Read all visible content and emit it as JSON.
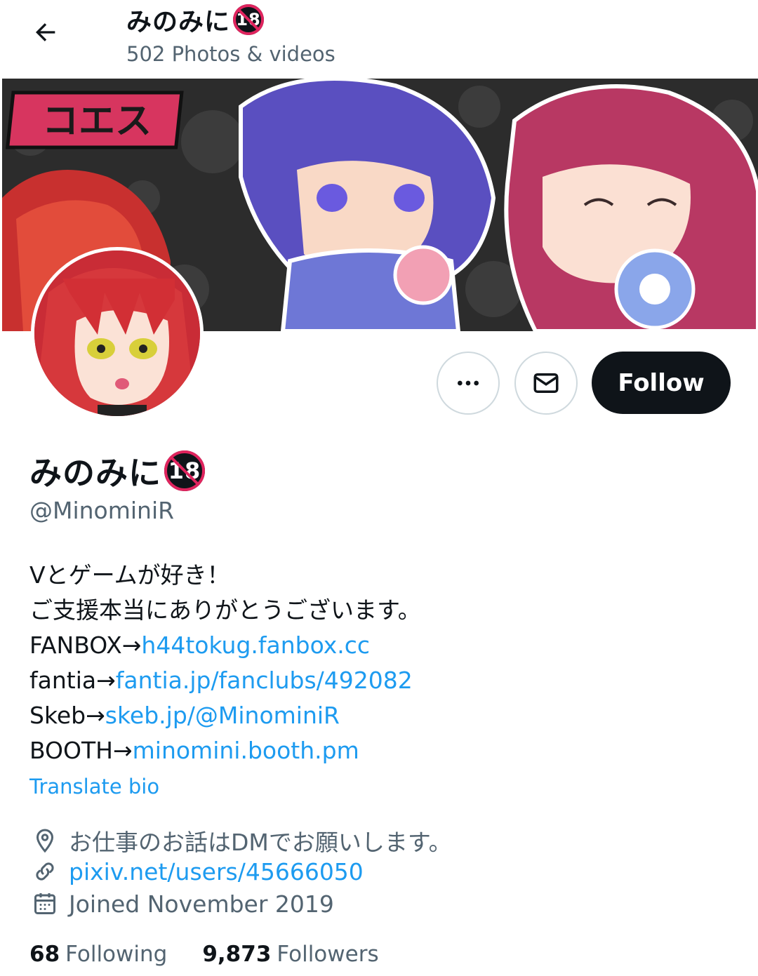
{
  "header": {
    "title": "みのみに",
    "badge": "18",
    "subtitle": "502 Photos & videos"
  },
  "banner": {
    "logo_text": "コエス"
  },
  "actions": {
    "follow_label": "Follow"
  },
  "profile": {
    "display_name": "みのみに",
    "badge": "18",
    "handle": "@MinominiR",
    "bio": {
      "line1": "Vとゲームが好き！",
      "line2": "ご支援本当にありがとうございます。",
      "links": [
        {
          "prefix": "FANBOX→",
          "url": "h44tokug.fanbox.cc"
        },
        {
          "prefix": "fantia→",
          "url": "fantia.jp/fanclubs/492082"
        },
        {
          "prefix": "Skeb→",
          "url": "skeb.jp/@MinominiR"
        },
        {
          "prefix": "BOOTH→",
          "url": "minomini.booth.pm"
        }
      ]
    },
    "translate_label": "Translate bio",
    "location": "お仕事のお話はDMでお願いします。",
    "website": "pixiv.net/users/45666050",
    "joined": "Joined November 2019",
    "following_count": "68",
    "following_label": "Following",
    "followers_count": "9,873",
    "followers_label": "Followers"
  },
  "colors": {
    "link": "#1d9bf0",
    "muted": "#536471",
    "text": "#0f1419",
    "badge_red": "#e0245e"
  },
  "icons": {
    "back": "arrow-left-icon",
    "more": "more-horizontal-icon",
    "message": "mail-icon",
    "location": "location-pin-icon",
    "website": "link-icon",
    "joined": "calendar-icon"
  }
}
